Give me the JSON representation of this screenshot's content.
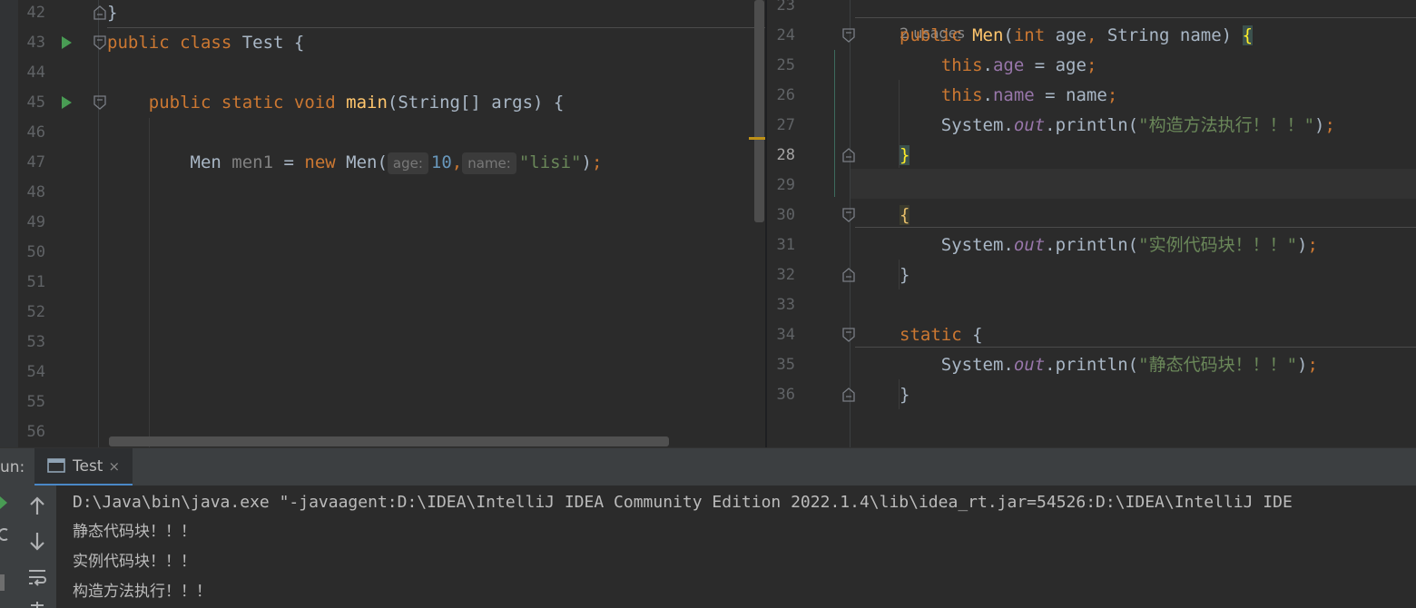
{
  "left_editor": {
    "lines": [
      {
        "num": "42",
        "tokens": [
          {
            "t": "}",
            "c": "var"
          }
        ]
      },
      {
        "num": "43",
        "tokens": [
          {
            "t": "public ",
            "c": "k"
          },
          {
            "t": "class ",
            "c": "k"
          },
          {
            "t": "Test {",
            "c": "var"
          }
        ]
      },
      {
        "num": "44",
        "tokens": []
      },
      {
        "num": "45",
        "tokens": [
          {
            "t": "    public ",
            "c": "k"
          },
          {
            "t": "static ",
            "c": "k"
          },
          {
            "t": "void ",
            "c": "k"
          },
          {
            "t": "main",
            "c": "fn"
          },
          {
            "t": "(String[] args) {",
            "c": "var"
          }
        ]
      },
      {
        "num": "46",
        "tokens": []
      },
      {
        "num": "47",
        "tokens": [
          {
            "t": "        Men ",
            "c": "var"
          },
          {
            "t": "men1",
            "c": "unused"
          },
          {
            "t": " = ",
            "c": "var"
          },
          {
            "t": "new ",
            "c": "k"
          },
          {
            "t": "Men(",
            "c": "var"
          },
          {
            "hint": "age:"
          },
          {
            "t": "10",
            "c": "num"
          },
          {
            "t": ",",
            "c": "k"
          },
          {
            "hint": "name:"
          },
          {
            "t": "\"lisi\"",
            "c": "str"
          },
          {
            "t": ")",
            "c": "var"
          },
          {
            "t": ";",
            "c": "k"
          }
        ]
      },
      {
        "num": "48",
        "tokens": []
      },
      {
        "num": "49",
        "tokens": []
      },
      {
        "num": "50",
        "tokens": []
      },
      {
        "num": "51",
        "tokens": []
      },
      {
        "num": "52",
        "tokens": []
      },
      {
        "num": "53",
        "tokens": []
      },
      {
        "num": "54",
        "tokens": []
      },
      {
        "num": "55",
        "tokens": []
      },
      {
        "num": "56",
        "tokens": []
      }
    ]
  },
  "right_editor": {
    "usages_label": "2 usages",
    "lines": [
      {
        "num": "23",
        "tokens": []
      },
      {
        "num": "24",
        "tokens": [
          {
            "t": "public ",
            "c": "k"
          },
          {
            "t": "Men",
            "c": "fn"
          },
          {
            "t": "(",
            "c": "var"
          },
          {
            "t": "int ",
            "c": "k"
          },
          {
            "t": "age",
            "c": "var"
          },
          {
            "t": ", ",
            "c": "k"
          },
          {
            "t": "String name) ",
            "c": "var"
          },
          {
            "t": "{",
            "c": "braceM"
          }
        ]
      },
      {
        "num": "25",
        "tokens": [
          {
            "t": "    this",
            "c": "k"
          },
          {
            "t": ".",
            "c": "var"
          },
          {
            "t": "age",
            "c": "fld"
          },
          {
            "t": " = age",
            "c": "var"
          },
          {
            "t": ";",
            "c": "k"
          }
        ]
      },
      {
        "num": "26",
        "tokens": [
          {
            "t": "    this",
            "c": "k"
          },
          {
            "t": ".",
            "c": "var"
          },
          {
            "t": "name",
            "c": "fld"
          },
          {
            "t": " = name",
            "c": "var"
          },
          {
            "t": ";",
            "c": "k"
          }
        ]
      },
      {
        "num": "27",
        "tokens": [
          {
            "t": "    System.",
            "c": "var"
          },
          {
            "t": "out",
            "c": "sfld"
          },
          {
            "t": ".println(",
            "c": "var"
          },
          {
            "t": "\"构造方法执行！！！\"",
            "c": "str"
          },
          {
            "t": ")",
            "c": "var"
          },
          {
            "t": ";",
            "c": "k"
          }
        ]
      },
      {
        "num": "28",
        "tokens": [
          {
            "t": "}",
            "c": "braceM"
          }
        ],
        "current": true
      },
      {
        "num": "29",
        "tokens": []
      },
      {
        "num": "30",
        "tokens": [
          {
            "t": "{",
            "c": "braceY"
          }
        ]
      },
      {
        "num": "31",
        "tokens": [
          {
            "t": "    System.",
            "c": "var"
          },
          {
            "t": "out",
            "c": "sfld"
          },
          {
            "t": ".println(",
            "c": "var"
          },
          {
            "t": "\"实例代码块！！！\"",
            "c": "str"
          },
          {
            "t": ")",
            "c": "var"
          },
          {
            "t": ";",
            "c": "k"
          }
        ]
      },
      {
        "num": "32",
        "tokens": [
          {
            "t": "}",
            "c": "var"
          }
        ]
      },
      {
        "num": "33",
        "tokens": []
      },
      {
        "num": "34",
        "tokens": [
          {
            "t": "static ",
            "c": "k"
          },
          {
            "t": "{",
            "c": "var"
          }
        ]
      },
      {
        "num": "35",
        "tokens": [
          {
            "t": "    System.",
            "c": "var"
          },
          {
            "t": "out",
            "c": "sfld"
          },
          {
            "t": ".println(",
            "c": "var"
          },
          {
            "t": "\"静态代码块！！！\"",
            "c": "str"
          },
          {
            "t": ")",
            "c": "var"
          },
          {
            "t": ";",
            "c": "k"
          }
        ]
      },
      {
        "num": "36",
        "tokens": [
          {
            "t": "}",
            "c": "var"
          }
        ]
      }
    ]
  },
  "run_panel": {
    "title": "un:",
    "tab_label": "Test",
    "tab_close": "×",
    "console_lines": [
      "D:\\Java\\bin\\java.exe \"-javaagent:D:\\IDEA\\IntelliJ IDEA Community Edition 2022.1.4\\lib\\idea_rt.jar=54526:D:\\IDEA\\IntelliJ IDE",
      "静态代码块！！！",
      "实例代码块！！！",
      "构造方法执行！！！"
    ],
    "toolbar_icons": [
      "run-icon",
      "up-arrow-icon",
      "rerun-icon",
      "down-arrow-icon",
      "stop-icon",
      "soft-wrap-icon",
      "pin-icon"
    ]
  },
  "colors": {
    "background": "#2b2b2b",
    "keyword": "#cc7832",
    "method": "#ffc66d",
    "number": "#6897bb",
    "string": "#6a8759",
    "field": "#9876aa",
    "run_gutter": "#499c54"
  }
}
